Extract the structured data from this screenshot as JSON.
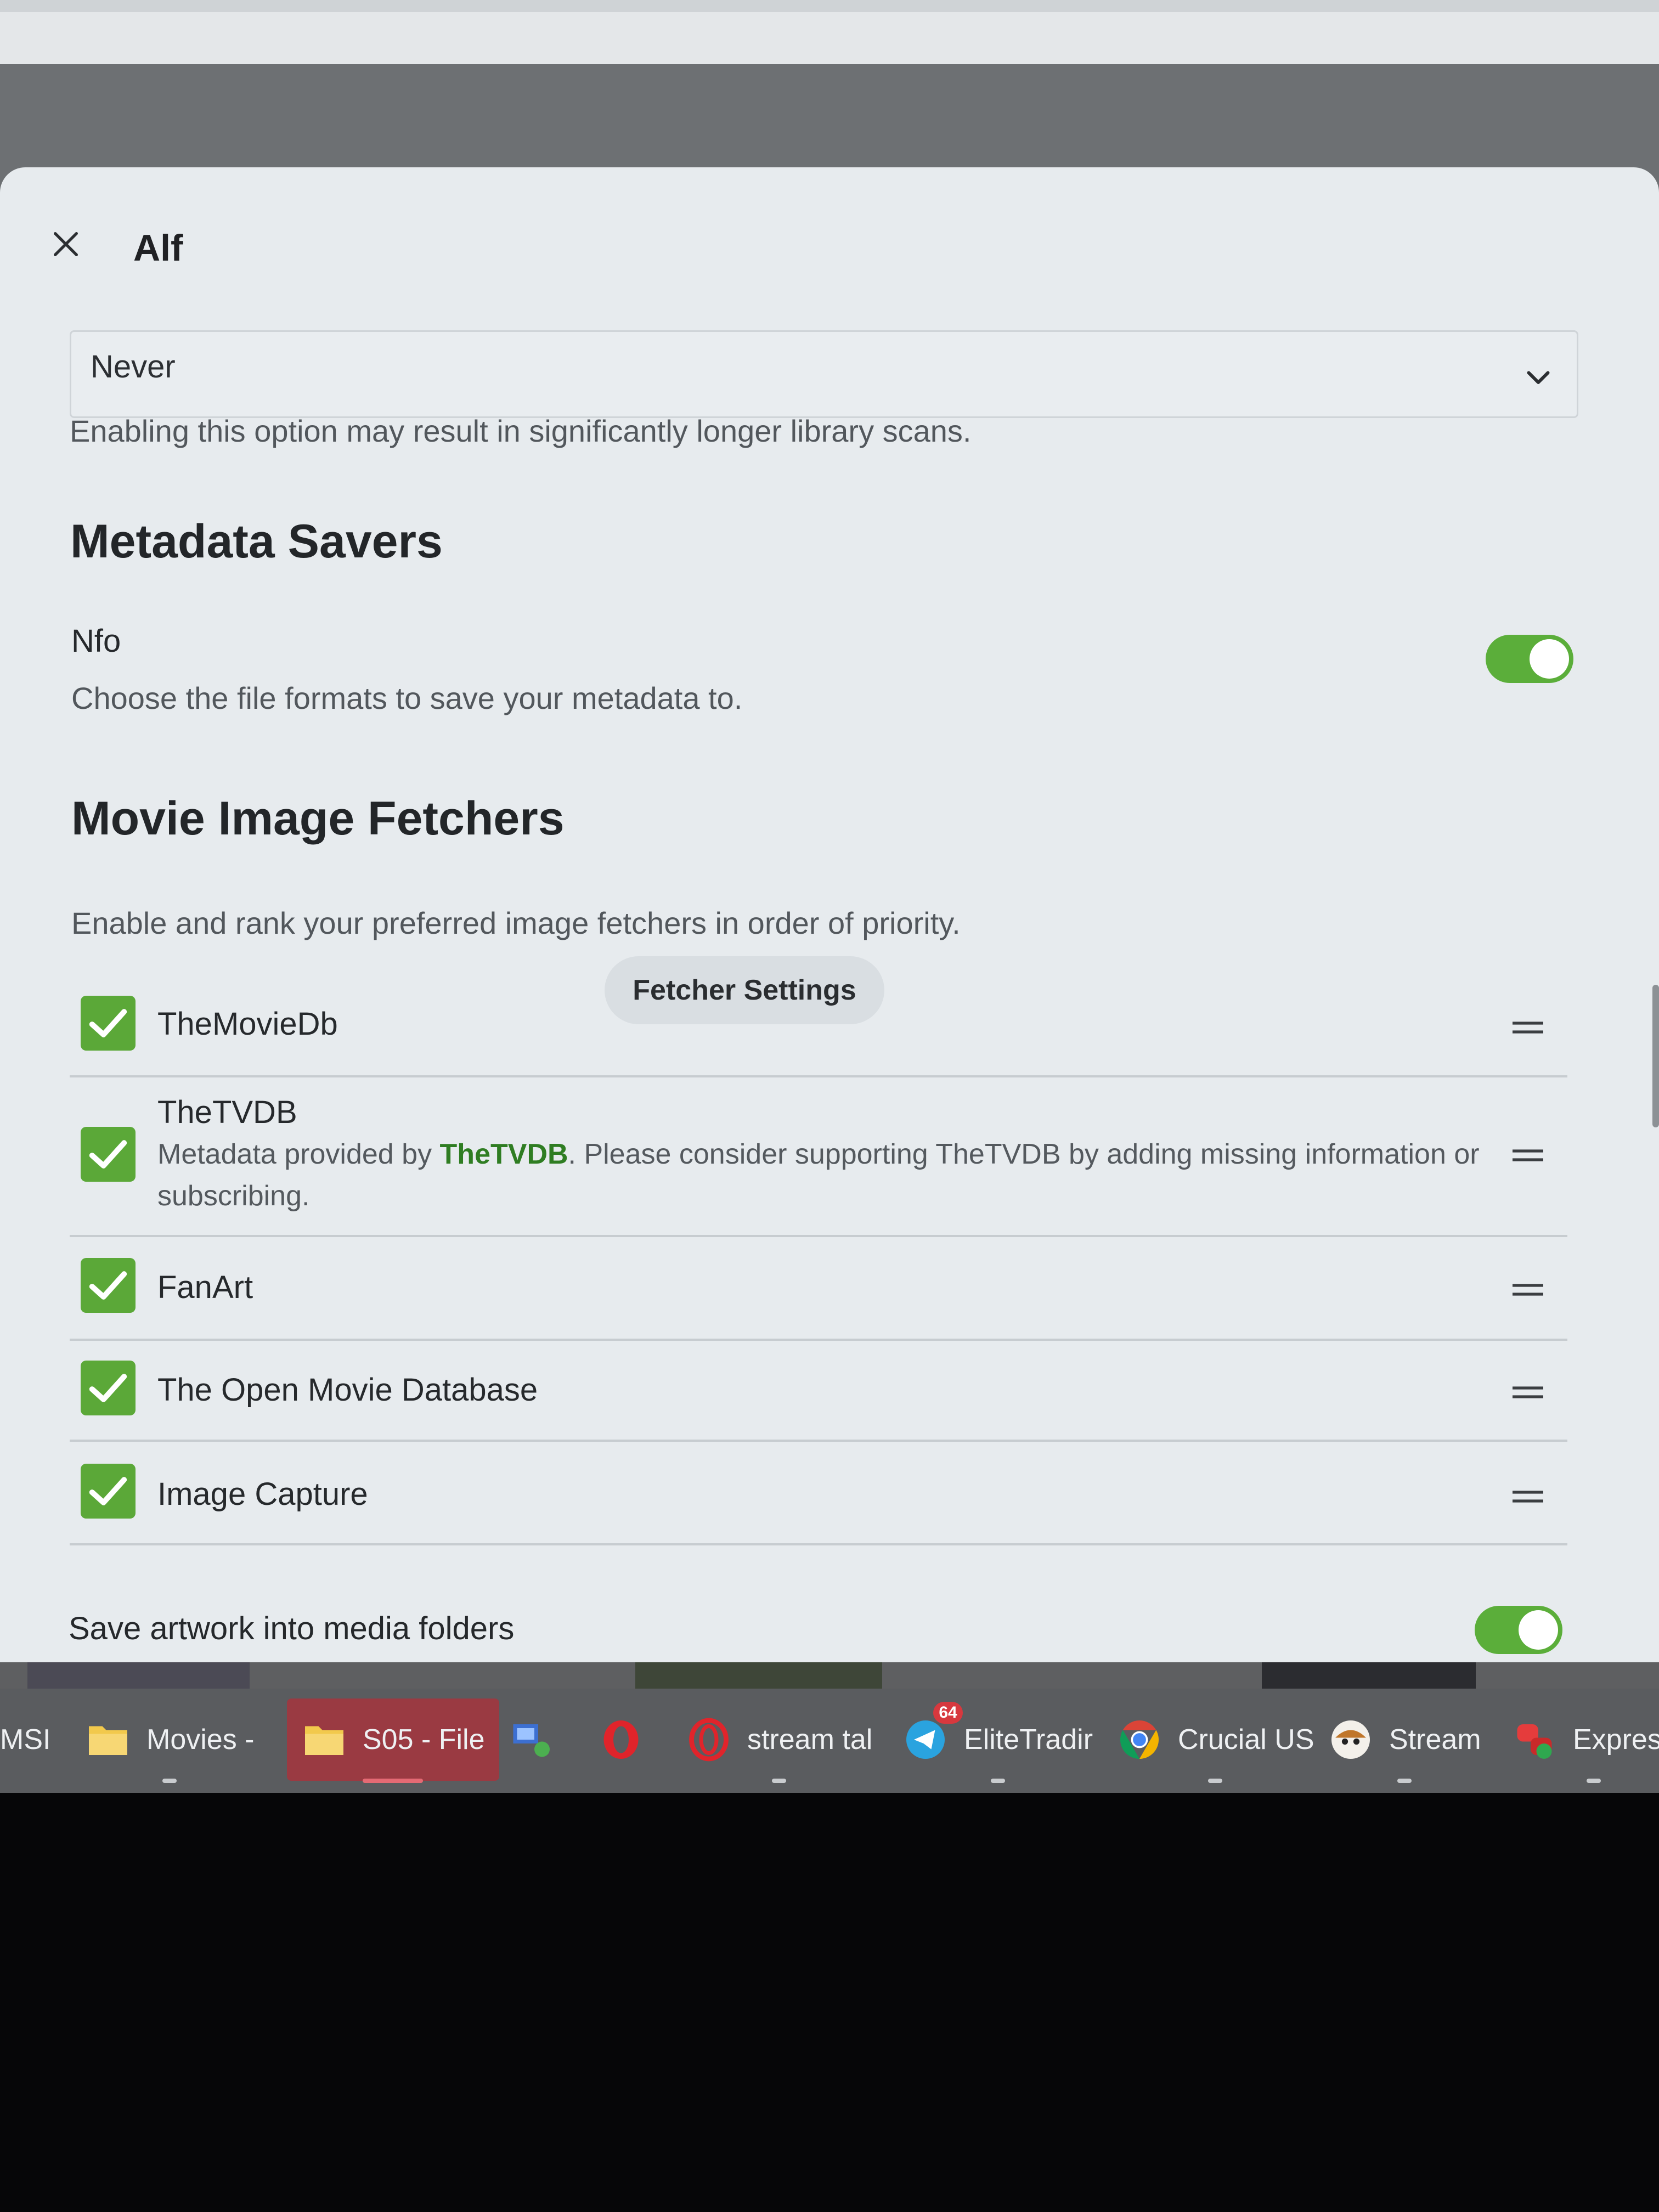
{
  "dialog": {
    "title": "Alf",
    "select": {
      "value": "Never"
    },
    "select_help": "Enabling this option may result in significantly longer library scans."
  },
  "metadata_savers": {
    "title": "Metadata Savers",
    "option_label": "Nfo",
    "option_enabled": true,
    "help": "Choose the file formats to save your metadata to."
  },
  "image_fetchers": {
    "title": "Movie Image Fetchers",
    "settings_button": "Fetcher Settings",
    "help": "Enable and rank your preferred image fetchers in order of priority.",
    "items": [
      {
        "name": "TheMovieDb",
        "checked": true
      },
      {
        "name": "TheTVDB",
        "checked": true,
        "desc_prefix": "Metadata provided by ",
        "desc_link": "TheTVDB",
        "desc_suffix": ". Please consider supporting TheTVDB by adding missing information or subscribing."
      },
      {
        "name": "FanArt",
        "checked": true
      },
      {
        "name": "The Open Movie Database",
        "checked": true
      },
      {
        "name": "Image Capture",
        "checked": true
      }
    ]
  },
  "save_artwork": {
    "label": "Save artwork into media folders",
    "enabled": true
  },
  "taskbar": {
    "items": [
      {
        "label": "MSI",
        "icon": "app-icon"
      },
      {
        "label": "Movies -",
        "icon": "folder-icon"
      },
      {
        "label": "S05 - File",
        "icon": "folder-icon",
        "active": true
      },
      {
        "label": "",
        "icon": "network-icon"
      },
      {
        "label": "",
        "icon": "opera-icon"
      },
      {
        "label": "stream tal",
        "icon": "opera-gx-icon"
      },
      {
        "label": "EliteTradir",
        "icon": "telegram-icon",
        "badge": "64"
      },
      {
        "label": "Crucial US",
        "icon": "chrome-icon"
      },
      {
        "label": "Stream",
        "icon": "streamlabs-icon"
      },
      {
        "label": "Express",
        "icon": "python-icon"
      }
    ]
  },
  "colors": {
    "accent_green": "#5ba838",
    "link_green": "#2f7d22",
    "active_task": "#9a3a42",
    "dialog_bg": "#e7ebee"
  }
}
